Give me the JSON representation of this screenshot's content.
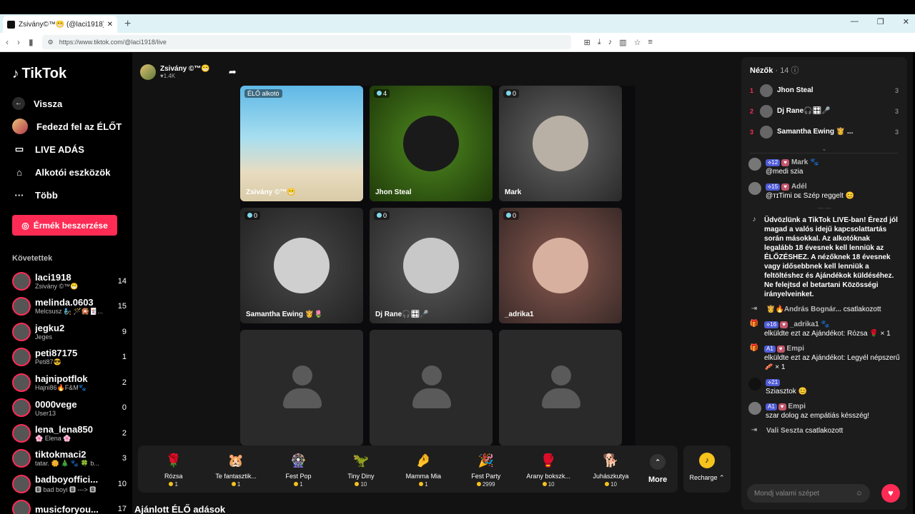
{
  "browser": {
    "tab_title": "Zsivány©™😁 (@laci1918) É...",
    "url": "https://www.tiktok.com/@laci1918/live"
  },
  "sidebar": {
    "logo": "TikTok",
    "nav": [
      {
        "label": "Vissza",
        "icon": "back-arrow-icon"
      },
      {
        "label": "Fedezd fel az ÉLŐT",
        "icon": "live-avatar-icon"
      },
      {
        "label": "LIVE ADÁS",
        "icon": "camera-icon"
      },
      {
        "label": "Alkotói eszközök",
        "icon": "creator-tools-icon"
      },
      {
        "label": "Több",
        "icon": "more-icon"
      }
    ],
    "coin_button": "Érmék beszerzése",
    "following_title": "Követettek",
    "following": [
      {
        "name": "laci1918",
        "sub": "Zsivány ©™😁",
        "count": "14"
      },
      {
        "name": "melinda.0603",
        "sub": "Melcsusz 🧞 🪄🎇🃏...",
        "count": "15"
      },
      {
        "name": "jegku2",
        "sub": "Jeges",
        "count": "9"
      },
      {
        "name": "peti87175",
        "sub": "Peti87😎",
        "count": "1"
      },
      {
        "name": "hajnipotflok",
        "sub": "Hajni86🔥F&M🐾",
        "count": "2"
      },
      {
        "name": "0000vege",
        "sub": "User13",
        "count": "0"
      },
      {
        "name": "lena_lena850",
        "sub": "🌸 Elena 🌸",
        "count": "2"
      },
      {
        "name": "tiktokmaci2",
        "sub": "tatar. 🌼 🎄 🐾 🍀 b...",
        "count": "3"
      },
      {
        "name": "badboyoffici...",
        "sub": "🅱 bad boyi 🅱 ---> 🅱",
        "count": "10"
      },
      {
        "name": "musicforyou...",
        "sub": "",
        "count": "17"
      }
    ]
  },
  "host": {
    "name": "Zsivány ©™😁",
    "likes": "♥1.4K"
  },
  "tiles": [
    {
      "label": "Zsivány ©™😁",
      "badge": "ÉLŐ alkotó",
      "kind": "beach"
    },
    {
      "label": "Jhon Steal",
      "badge": "4",
      "kind": "javi"
    },
    {
      "label": "Mark",
      "badge": "0",
      "kind": "dogs"
    },
    {
      "label": "Samantha Ewing 👸🌷",
      "badge": "0",
      "kind": "woman"
    },
    {
      "label": "Dj Rane🎧🎛🎤",
      "badge": "0",
      "kind": "mixer"
    },
    {
      "label": "_adrika1",
      "badge": "0",
      "kind": "selfie"
    },
    {
      "label": "",
      "badge": "",
      "kind": "empty"
    },
    {
      "label": "",
      "badge": "",
      "kind": "empty"
    },
    {
      "label": "",
      "badge": "",
      "kind": "empty"
    }
  ],
  "gifts": [
    {
      "name": "Rózsa",
      "price": "1",
      "icon": "🌹"
    },
    {
      "name": "Te fantasztik...",
      "price": "1",
      "icon": "🐹"
    },
    {
      "name": "Fest Pop",
      "price": "1",
      "icon": "🎡"
    },
    {
      "name": "Tiny Diny",
      "price": "10",
      "icon": "🦖"
    },
    {
      "name": "Mamma Mia",
      "price": "1",
      "icon": "🤌"
    },
    {
      "name": "Fest Party",
      "price": "2999",
      "icon": "🎉"
    },
    {
      "name": "Arany bokszk...",
      "price": "10",
      "icon": "🥊"
    },
    {
      "name": "Juhászkutya",
      "price": "10",
      "icon": "🐕"
    }
  ],
  "more_label": "More",
  "recharge_label": "Recharge ⌃",
  "suggested_title": "Ajánlott ÉLŐ adások",
  "chat": {
    "viewers_label": "Nézők",
    "viewers_count": "· 14",
    "top_viewers": [
      {
        "rank": "1",
        "name": "Jhon Steal",
        "score": "3"
      },
      {
        "rank": "2",
        "name": "Dj Rane🎧🎛🎤",
        "score": "3"
      },
      {
        "rank": "3",
        "name": "Samantha Ewing 👸 ...",
        "score": "3"
      }
    ],
    "messages": [
      {
        "level": "12",
        "user": "Mark 🐾",
        "text": "@medi szia"
      },
      {
        "level": "15",
        "user": "Adél",
        "text": "@ᴛɪTimi ᴅᴇ Szép reggelt 😊"
      }
    ],
    "welcome": "Üdvözlünk a TikTok LIVE-ban! Érezd jól magad a valós idejű kapcsolattartás során másokkal. Az alkotóknak legalább 18 évesnek kell lenniük az ÉLŐZÉSHEZ. A nézőknek 18 évesnek vagy idősebbnek kell lenniük a feltöltéshez és Ajándékok küldéséhez. Ne felejtsd el betartani Közösségi irányelveinket.",
    "joined1": {
      "user": "👸🔥András Bognár...",
      "action": "csatlakozott"
    },
    "gift1": {
      "level": "16",
      "user": "_adrika1 🐾",
      "text": "elküldte ezt az Ajándékot: Rózsa 🌹 × 1"
    },
    "gift2": {
      "level": "1",
      "user": "Empi",
      "text": "elküldte ezt az Ajándékot: Legyél népszerű 🥓 × 1"
    },
    "msg3": {
      "level": "21",
      "text": "Sziasztok 😊"
    },
    "msg4": {
      "level": "1",
      "user": "Empi",
      "text": "szar dolog az empátiás késszég!"
    },
    "joined2": {
      "user": "Vali Seszta",
      "action": "csatlakozott"
    },
    "input_placeholder": "Mondj valami szépet"
  }
}
